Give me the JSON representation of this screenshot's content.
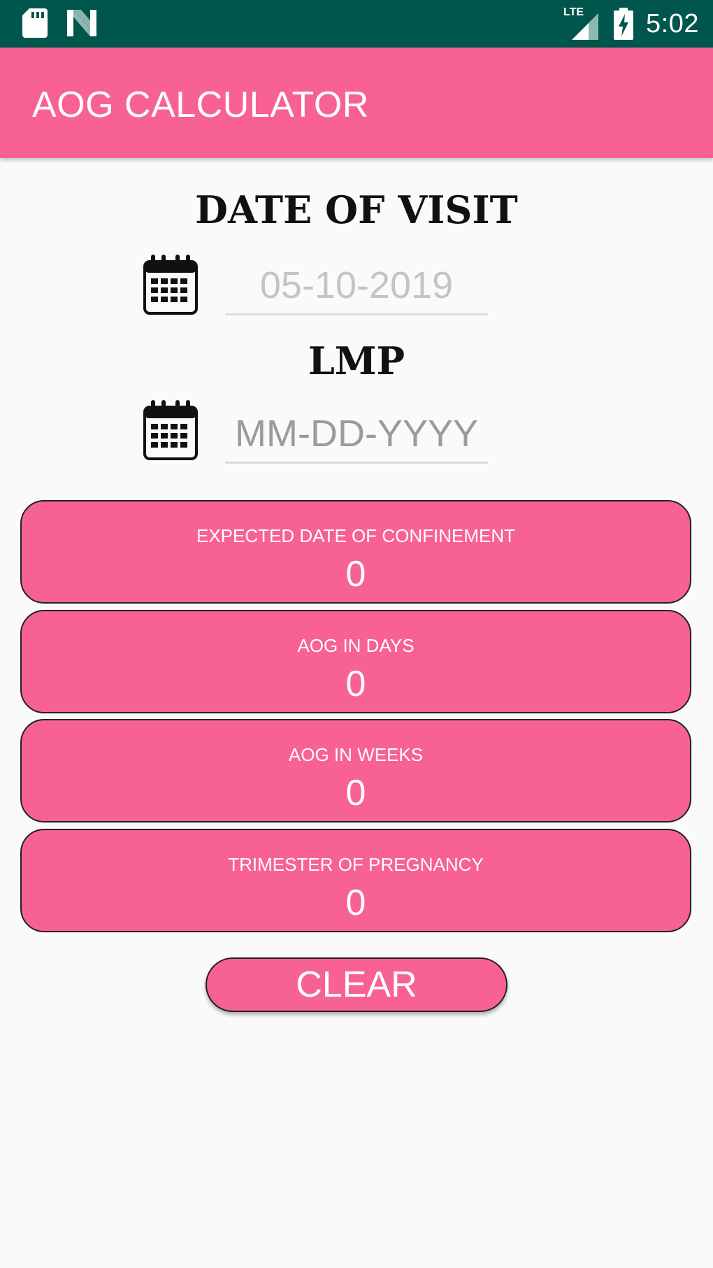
{
  "status_bar": {
    "time": "5:02",
    "network": "LTE",
    "left_icons": [
      "sd-card-icon",
      "n-notification-icon"
    ],
    "right_icons": [
      "lte-signal-icon",
      "battery-charging-icon"
    ]
  },
  "app_bar": {
    "title": "AOG CALCULATOR"
  },
  "visit": {
    "heading": "DATE OF VISIT",
    "value": "05-10-2019",
    "icon": "calendar-icon"
  },
  "lmp": {
    "heading": "LMP",
    "placeholder": "MM-DD-YYYY",
    "icon": "calendar-icon"
  },
  "results": [
    {
      "label": "EXPECTED DATE OF CONFINEMENT",
      "value": "0"
    },
    {
      "label": "AOG IN DAYS",
      "value": "0"
    },
    {
      "label": "AOG IN WEEKS",
      "value": "0"
    },
    {
      "label": "TRIMESTER OF PREGNANCY",
      "value": "0"
    }
  ],
  "clear_button": {
    "label": "CLEAR"
  },
  "colors": {
    "status_bar": "#00564c",
    "accent_pink": "#f76195",
    "background": "#fafafa"
  }
}
